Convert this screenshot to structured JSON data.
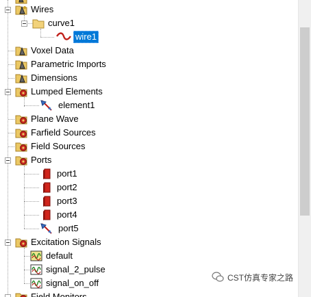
{
  "tree": {
    "items": [
      {
        "label": "Wires"
      },
      {
        "label": "curve1"
      },
      {
        "label": "wire1"
      },
      {
        "label": "Voxel Data"
      },
      {
        "label": "Parametric Imports"
      },
      {
        "label": "Dimensions"
      },
      {
        "label": "Lumped Elements"
      },
      {
        "label": "element1"
      },
      {
        "label": "Plane Wave"
      },
      {
        "label": "Farfield Sources"
      },
      {
        "label": "Field Sources"
      },
      {
        "label": "Ports"
      },
      {
        "label": "port1"
      },
      {
        "label": "port2"
      },
      {
        "label": "port3"
      },
      {
        "label": "port4"
      },
      {
        "label": "port5"
      },
      {
        "label": "Excitation Signals"
      },
      {
        "label": "default"
      },
      {
        "label": "signal_2_pulse"
      },
      {
        "label": "signal_on_off"
      },
      {
        "label": "Field Monitors"
      }
    ]
  },
  "watermark": {
    "text": "CST仿真专家之路"
  }
}
